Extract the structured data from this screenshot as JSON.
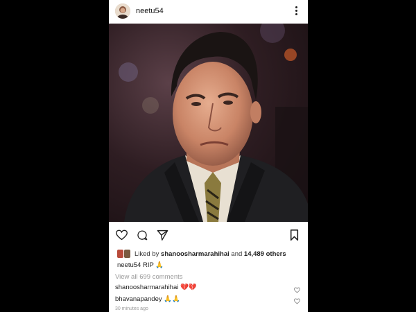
{
  "post": {
    "username": "neetu54",
    "liked_by_prefix": "Liked by",
    "liked_by_user": "shanoosharmarahihai",
    "liked_by_and": "and",
    "liked_by_others": "14,489 others",
    "caption_user": "neetu54",
    "caption_text": "RIP",
    "caption_emoji": "🙏",
    "view_all_comments": "View all 699 comments",
    "comments": [
      {
        "user": "shanoosharmarahihai",
        "emoji": "💔💔"
      },
      {
        "user": "bhavanapandey",
        "emoji": "🙏🙏"
      }
    ],
    "timestamp": "30 minutes ago"
  },
  "icons": {
    "more": "more-vertical-icon",
    "like": "heart-icon",
    "comment": "comment-icon",
    "share": "send-icon",
    "save": "bookmark-icon"
  }
}
